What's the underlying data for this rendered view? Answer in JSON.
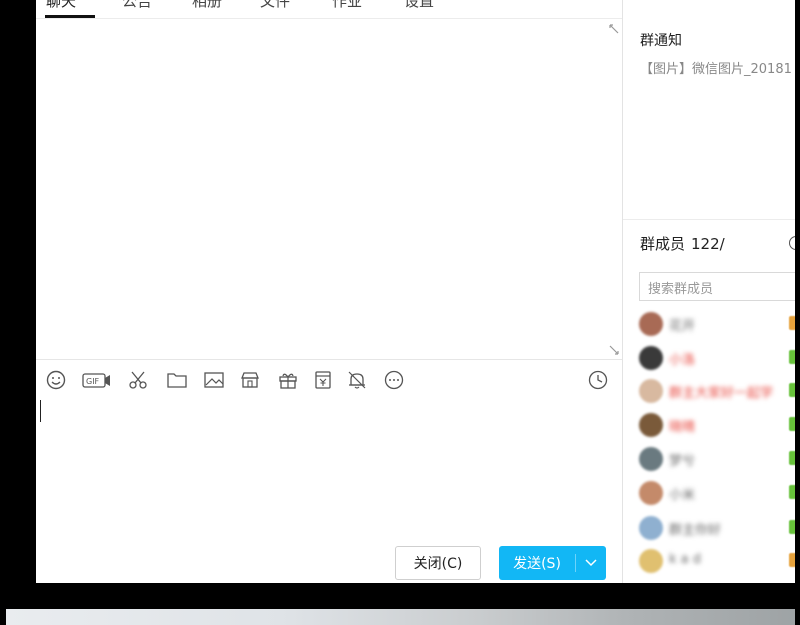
{
  "tabs": [
    "聊天",
    "公告",
    "相册",
    "文件",
    "作业",
    "设置"
  ],
  "chat": {
    "toolbar_icons": [
      "smiley-icon",
      "gif-icon",
      "scissors-icon",
      "folder-icon",
      "image-icon",
      "shop-icon",
      "gift-icon",
      "red-packet-icon",
      "bell-icon",
      "more-icon",
      "history-clock-icon"
    ]
  },
  "buttons": {
    "close_label": "关闭(C)",
    "send_label": "发送(S)",
    "send_dropdown": "⌄"
  },
  "panel": {
    "notice_title": "群通知",
    "notice_text": "【图片】微信图片_20181",
    "members_title": "群成员",
    "members_count": "122/",
    "search_placeholder": "搜索群成员"
  },
  "members": [
    {
      "name": "花开",
      "name_color": "#666666",
      "avatar_color": "#a86a55",
      "level_color": "#e6a23c"
    },
    {
      "name": "小洛",
      "name_color": "#e8453c",
      "avatar_color": "#3a3a3a",
      "level_color": "#67c23a"
    },
    {
      "name": "群主大家好一起学",
      "name_color": "#e8453c",
      "avatar_color": "#d8b9a0",
      "level_color": "#67c23a"
    },
    {
      "name": "晓晴",
      "name_color": "#e8453c",
      "avatar_color": "#7a5a3a",
      "level_color": "#67c23a"
    },
    {
      "name": "梦兮",
      "name_color": "#666666",
      "avatar_color": "#6a7a80",
      "level_color": "#67c23a"
    },
    {
      "name": "小米",
      "name_color": "#666666",
      "avatar_color": "#c48a6a",
      "level_color": "#67c23a"
    },
    {
      "name": "群主你好",
      "name_color": "#666666",
      "avatar_color": "#8fb0d0",
      "level_color": "#67c23a"
    },
    {
      "name": "k a d",
      "name_color": "#666666",
      "avatar_color": "#e0c070",
      "level_color": "#e6a23c"
    }
  ]
}
